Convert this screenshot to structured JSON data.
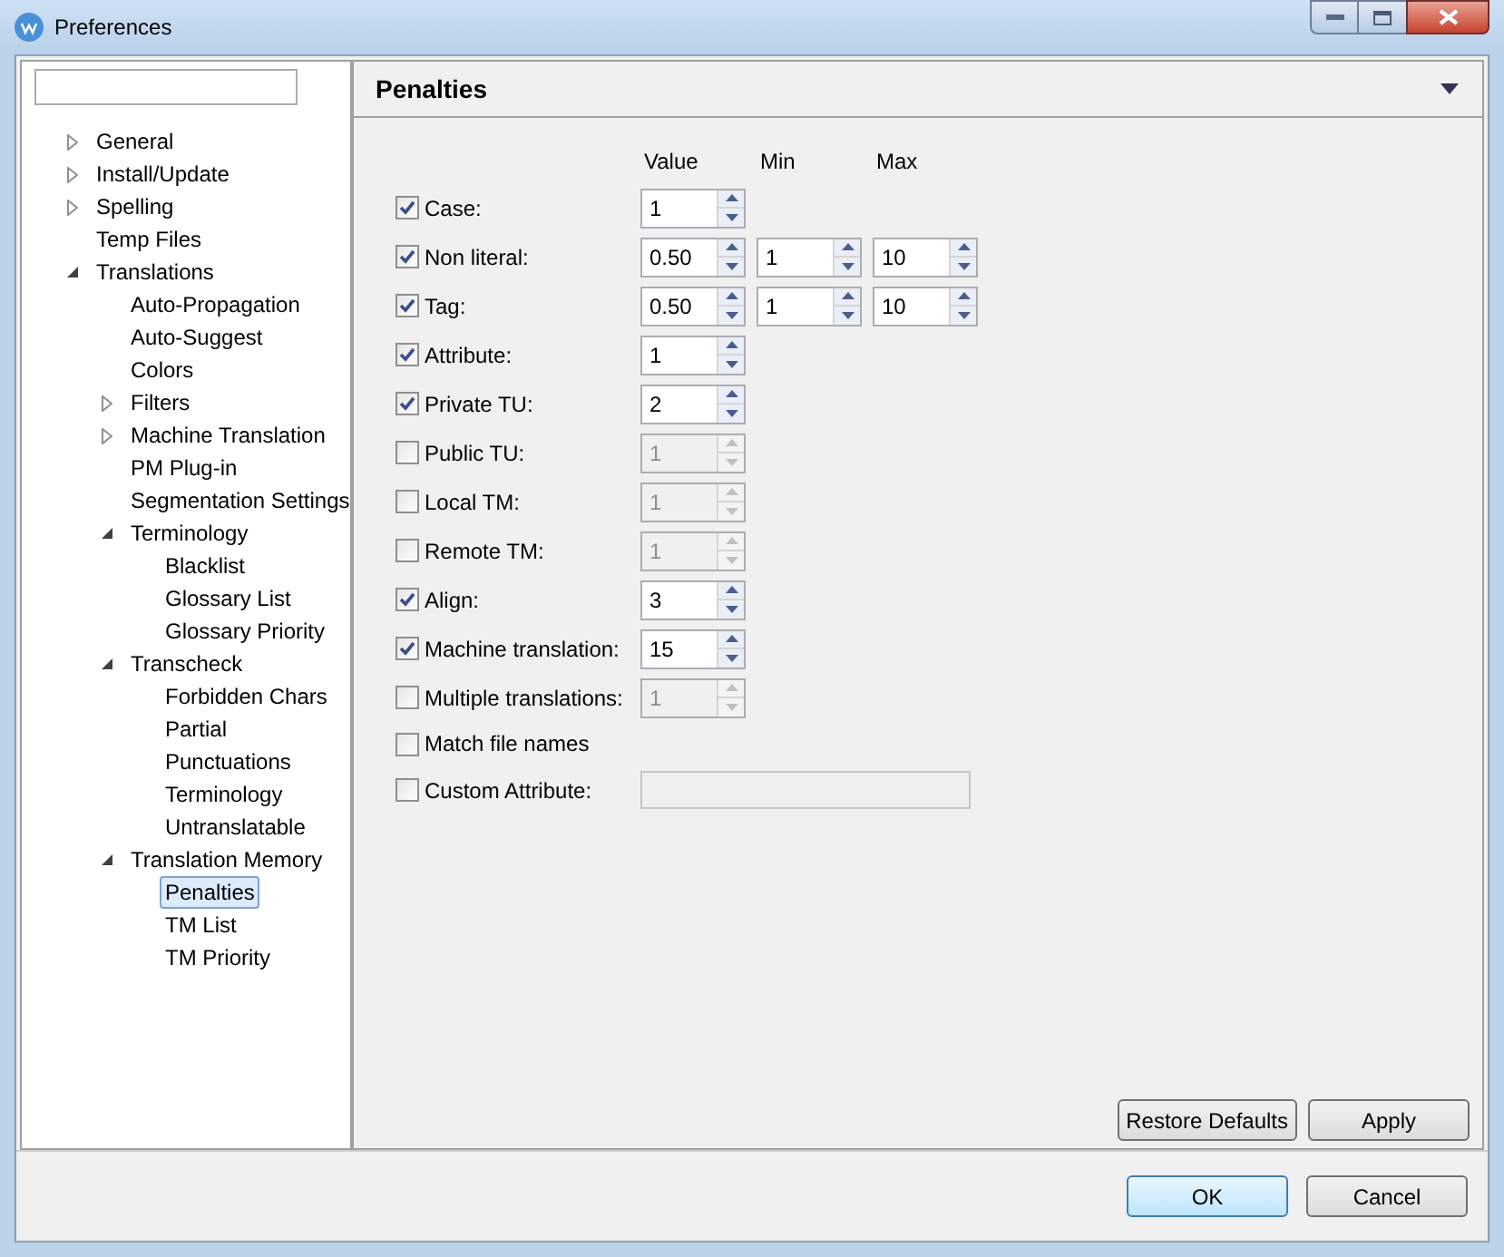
{
  "window": {
    "title": "Preferences"
  },
  "tree": [
    {
      "label": "General",
      "expanded": false,
      "selected": false
    },
    {
      "label": "Install/Update",
      "expanded": false,
      "selected": false
    },
    {
      "label": "Spelling",
      "expanded": false,
      "selected": false
    },
    {
      "label": "Temp Files",
      "selected": false
    },
    {
      "label": "Translations",
      "expanded": true,
      "selected": false,
      "children": [
        {
          "label": "Auto-Propagation",
          "selected": false
        },
        {
          "label": "Auto-Suggest",
          "selected": false
        },
        {
          "label": "Colors",
          "selected": false
        },
        {
          "label": "Filters",
          "expanded": false,
          "selected": false
        },
        {
          "label": "Machine Translation",
          "expanded": false,
          "selected": false
        },
        {
          "label": "PM Plug-in",
          "selected": false
        },
        {
          "label": "Segmentation Settings",
          "selected": false
        },
        {
          "label": "Terminology",
          "expanded": true,
          "selected": false,
          "children": [
            {
              "label": "Blacklist",
              "selected": false
            },
            {
              "label": "Glossary List",
              "selected": false
            },
            {
              "label": "Glossary Priority",
              "selected": false
            }
          ]
        },
        {
          "label": "Transcheck",
          "expanded": true,
          "selected": false,
          "children": [
            {
              "label": "Forbidden Chars",
              "selected": false
            },
            {
              "label": "Partial",
              "selected": false
            },
            {
              "label": "Punctuations",
              "selected": false
            },
            {
              "label": "Terminology",
              "selected": false
            },
            {
              "label": "Untranslatable",
              "selected": false
            }
          ]
        },
        {
          "label": "Translation Memory",
          "expanded": true,
          "selected": false,
          "children": [
            {
              "label": "Penalties",
              "selected": true
            },
            {
              "label": "TM List",
              "selected": false
            },
            {
              "label": "TM Priority",
              "selected": false
            }
          ]
        }
      ]
    }
  ],
  "page": {
    "title": "Penalties",
    "columns": [
      "Value",
      "Min",
      "Max"
    ],
    "rows": [
      {
        "kind": "spinner",
        "label": "Case:",
        "checked": true,
        "value": "1",
        "disabled": false
      },
      {
        "kind": "range",
        "label": "Non literal:",
        "checked": true,
        "value": "0.50",
        "min": "1",
        "max": "10",
        "disabled": false
      },
      {
        "kind": "range",
        "label": "Tag:",
        "checked": true,
        "value": "0.50",
        "min": "1",
        "max": "10",
        "disabled": false
      },
      {
        "kind": "spinner",
        "label": "Attribute:",
        "checked": true,
        "value": "1",
        "disabled": false
      },
      {
        "kind": "spinner",
        "label": "Private TU:",
        "checked": true,
        "value": "2",
        "disabled": false
      },
      {
        "kind": "spinner",
        "label": "Public TU:",
        "checked": false,
        "value": "1",
        "disabled": true
      },
      {
        "kind": "spinner",
        "label": "Local TM:",
        "checked": false,
        "value": "1",
        "disabled": true
      },
      {
        "kind": "spinner",
        "label": "Remote TM:",
        "checked": false,
        "value": "1",
        "disabled": true
      },
      {
        "kind": "spinner",
        "label": "Align:",
        "checked": true,
        "value": "3",
        "disabled": false
      },
      {
        "kind": "spinner",
        "label": "Machine translation:",
        "checked": true,
        "value": "15",
        "disabled": false
      },
      {
        "kind": "spinner",
        "label": "Multiple translations:",
        "checked": false,
        "value": "1",
        "disabled": true
      },
      {
        "kind": "checkbox",
        "label": "Match file names",
        "checked": false
      },
      {
        "kind": "text",
        "label": "Custom Attribute:",
        "checked": false,
        "disabled": true
      }
    ],
    "buttons": [
      "Restore Defaults",
      "Apply"
    ]
  },
  "footer_buttons": [
    {
      "label": "OK",
      "default": true
    },
    {
      "label": "Cancel",
      "default": false
    }
  ]
}
